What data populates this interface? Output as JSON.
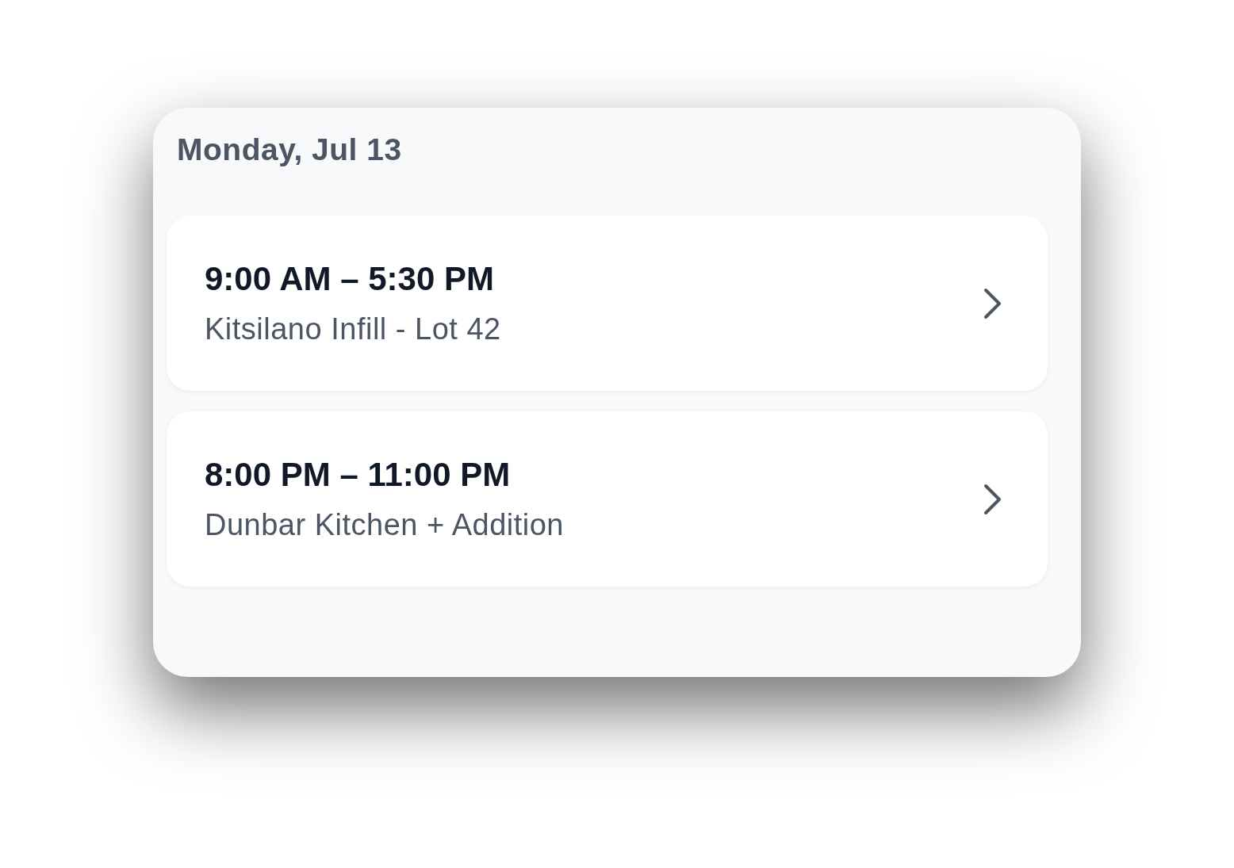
{
  "day_header": "Monday, Jul 13",
  "shifts": [
    {
      "time": "9:00 AM – 5:30 PM",
      "project": "Kitsilano Infill - Lot 42"
    },
    {
      "time": "8:00 PM – 11:00 PM",
      "project": "Dunbar Kitchen + Addition"
    }
  ]
}
